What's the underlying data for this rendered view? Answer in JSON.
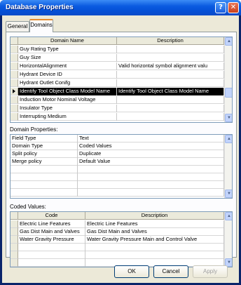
{
  "window": {
    "title": "Database Properties",
    "help_glyph": "?",
    "close_glyph": "✕"
  },
  "tabs": [
    {
      "label": "General",
      "active": false
    },
    {
      "label": "Domains",
      "active": true
    }
  ],
  "domains_table": {
    "headers": [
      "Domain Name",
      "Description"
    ],
    "rows": [
      {
        "name": "Guy Rating Type",
        "description": ""
      },
      {
        "name": "Guy Size",
        "description": ""
      },
      {
        "name": "HorizontalAlignment",
        "description": "Valid horizontal symbol alignment valu"
      },
      {
        "name": "Hydrant Device ID",
        "description": ""
      },
      {
        "name": "Hydrant Outlet Conifg",
        "description": ""
      },
      {
        "name": "Identify Tool Object Class Model Name",
        "description": "Identify Tool Object Class Model Name",
        "selected": true
      },
      {
        "name": "Induction Motor Nominal Voltage",
        "description": ""
      },
      {
        "name": "Insulator Type",
        "description": ""
      },
      {
        "name": "Interrupting Medium",
        "description": ""
      }
    ]
  },
  "domain_properties": {
    "label": "Domain Properties:",
    "rows": [
      {
        "property": "Field Type",
        "value": "Text"
      },
      {
        "property": "Domain Type",
        "value": "Coded Values"
      },
      {
        "property": "Split policy",
        "value": "Duplicate"
      },
      {
        "property": "Merge policy",
        "value": "Default Value"
      },
      {
        "property": "",
        "value": ""
      },
      {
        "property": "",
        "value": ""
      },
      {
        "property": "",
        "value": ""
      },
      {
        "property": "",
        "value": ""
      }
    ]
  },
  "coded_values": {
    "label": "Coded Values:",
    "headers": [
      "Code",
      "Description"
    ],
    "rows": [
      {
        "code": "Electric Line Features",
        "description": "Electric Line Features"
      },
      {
        "code": "Gas Dist Main and Valves",
        "description": "Gas Dist Main and Valves"
      },
      {
        "code": "Water Gravity Pressure",
        "description": "Water Gravity Pressure Main and Control Valve"
      },
      {
        "code": "",
        "description": ""
      },
      {
        "code": "",
        "description": ""
      },
      {
        "code": "",
        "description": ""
      }
    ]
  },
  "buttons": {
    "ok": "OK",
    "cancel": "Cancel",
    "apply": "Apply"
  },
  "colors": {
    "title_bar": "#0a5ae0",
    "dialog_bg": "#ece9d8",
    "selection": "#000000",
    "tab_accent": "#e68b2c"
  }
}
